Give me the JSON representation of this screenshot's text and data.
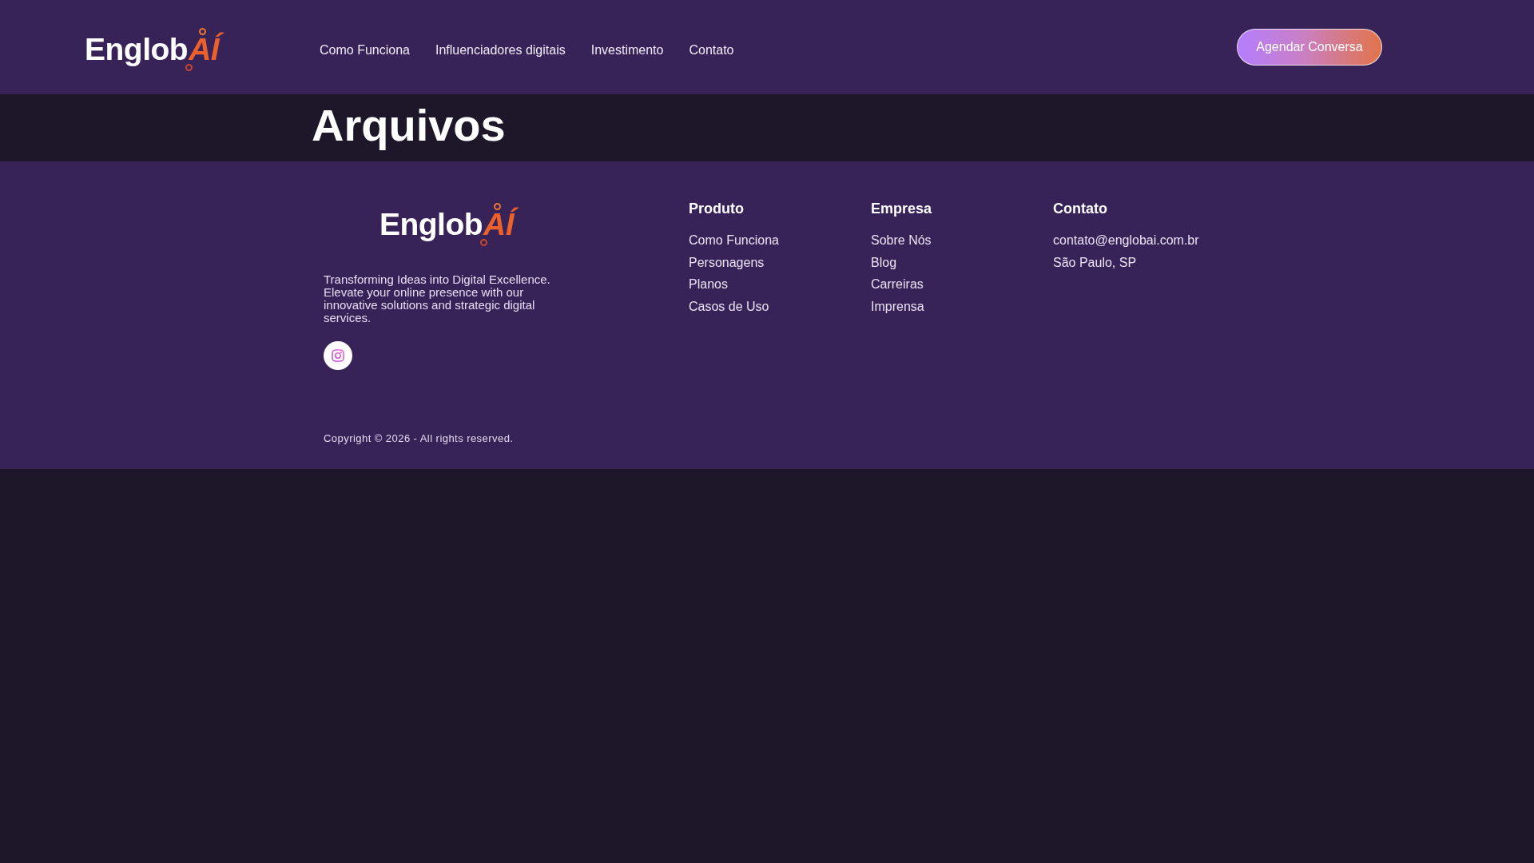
{
  "header": {
    "logo": {
      "text": "Englob",
      "accent": "AÍ"
    },
    "nav": [
      "Como Funciona",
      "Influenciadores digitais",
      "Investimento",
      "Contato"
    ],
    "cta": "Agendar Conversa"
  },
  "page_title": "Arquivos",
  "footer": {
    "logo": {
      "text": "Englob",
      "accent": "AÍ"
    },
    "tagline": "Transforming Ideas into Digital Excellence. Elevate your online presence with our innovative solutions and strategic digital services.",
    "columns": [
      {
        "title": "Produto",
        "items": [
          "Como Funciona",
          "Personagens",
          "Planos",
          "Casos de Uso"
        ]
      },
      {
        "title": "Empresa",
        "items": [
          "Sobre Nós",
          "Blog",
          "Carreiras",
          "Imprensa"
        ]
      },
      {
        "title": "Contato",
        "items": [
          "contato@englobai.com.br",
          "São Paulo, SP"
        ]
      }
    ],
    "copyright": "Copyright © 2026 - All rights reserved."
  }
}
